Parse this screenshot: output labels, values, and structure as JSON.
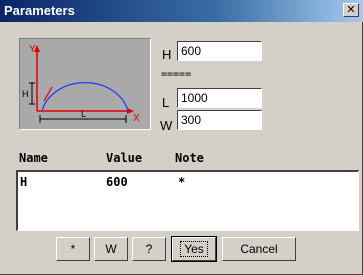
{
  "window": {
    "title": "Parameters",
    "close_glyph": "✕"
  },
  "diagram": {
    "label_y": "Y",
    "label_x": "X",
    "label_h": "H",
    "label_l": "L"
  },
  "fields": {
    "h_label": "H",
    "h_value": "600",
    "separator": "=====",
    "l_label": "L",
    "l_value": "1000",
    "w_label": "W",
    "w_value": "300"
  },
  "table": {
    "headers": [
      "Name",
      "Value",
      "Note"
    ],
    "rows": [
      {
        "name": "H",
        "value": "600",
        "note": "*"
      }
    ]
  },
  "buttons": {
    "star": "*",
    "w": "W",
    "help": "?",
    "yes": "Yes",
    "cancel": "Cancel"
  },
  "colors": {
    "title_gradient_start": "#0a246a",
    "title_gradient_end": "#a6caf0",
    "dialog_bg": "#d4d0c8",
    "diagram_bg": "#a9a9a9",
    "arc": "#1e3cff",
    "axis_arrow": "#e00000"
  }
}
